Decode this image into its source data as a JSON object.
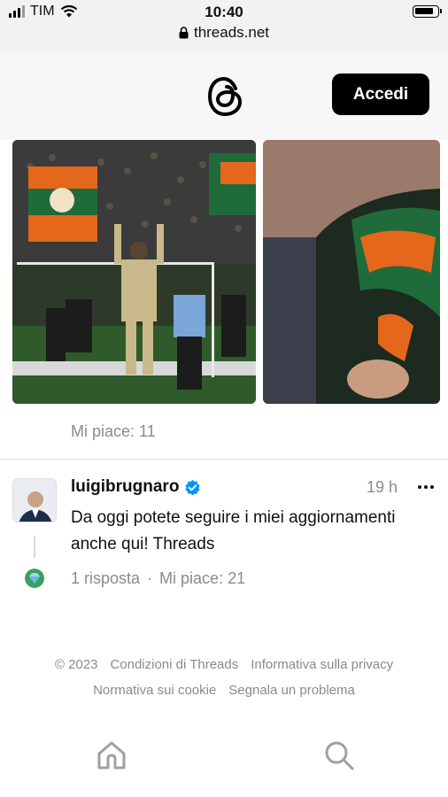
{
  "status_bar": {
    "carrier": "TIM",
    "time": "10:40",
    "battery_level": 0.85,
    "url": "threads.net"
  },
  "header": {
    "logo_icon": "threads-logo-icon",
    "login_label": "Accedi"
  },
  "previous_post": {
    "likes": "Mi piace: 11"
  },
  "post": {
    "username": "luigibrugnaro",
    "verified": true,
    "time": "19 h",
    "text": "Da oggi potete seguire i miei aggiornamenti anche qui! Threads",
    "replies": "1 risposta",
    "separator": "·",
    "likes": "Mi piace: 21"
  },
  "footer": {
    "copyright": "© 2023",
    "links": [
      "Condizioni di Threads",
      "Informativa sulla privacy",
      "Normativa sui cookie",
      "Segnala un problema"
    ]
  },
  "nav": {
    "home_icon": "home-icon",
    "search_icon": "search-icon"
  },
  "colors": {
    "accent": "#000000",
    "muted": "#8a8a8a",
    "verified": "#0095f6",
    "venezia_green": "#1f6b3a",
    "venezia_orange": "#e4671c"
  }
}
